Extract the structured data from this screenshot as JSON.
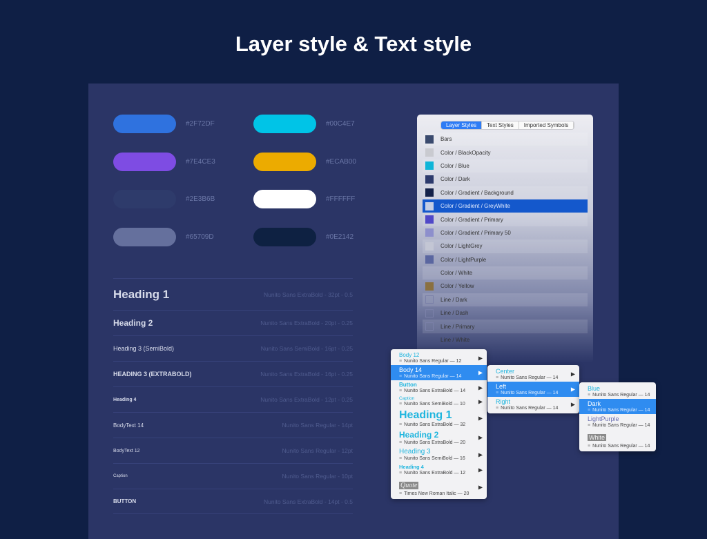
{
  "title": "Layer style & Text style",
  "swatches": [
    {
      "color": "#2F72DF",
      "label": "#2F72DF"
    },
    {
      "color": "#00C4E7",
      "label": "#00C4E7"
    },
    {
      "color": "#7E4CE3",
      "label": "#7E4CE3"
    },
    {
      "color": "#ECAB00",
      "label": "#ECAB00"
    },
    {
      "color": "#2E3B6B",
      "label": "#2E3B6B"
    },
    {
      "color": "#FFFFFF",
      "label": "#FFFFFF"
    },
    {
      "color": "#65709D",
      "label": "#65709D"
    },
    {
      "color": "#0E2142",
      "label": "#0E2142"
    }
  ],
  "text_styles": [
    {
      "name": "Heading 1",
      "spec": "Nunito Sans ExtraBold - 32pt - 0.5"
    },
    {
      "name": "Heading 2",
      "spec": "Nunito Sans ExtraBold - 20pt - 0.25"
    },
    {
      "name": "Heading 3 (SemiBold)",
      "spec": "Nunito Sans SemiBold - 16pt - 0.25"
    },
    {
      "name": "HEADING 3 (EXTRABOLD)",
      "spec": "Nunito Sans ExtraBold - 16pt - 0.25"
    },
    {
      "name": "Heading 4",
      "spec": "Nunito Sans ExtraBold - 12pt - 0.25"
    },
    {
      "name": "BodyText 14",
      "spec": "Nunito Sans Regular - 14pt"
    },
    {
      "name": "BodyText 12",
      "spec": "Nunito Sans Regular - 12pt"
    },
    {
      "name": "Caption",
      "spec": "Nunito Sans Regular - 10pt"
    },
    {
      "name": "BUTTON",
      "spec": "Nunito Sans ExtraBold - 14pt - 0.5"
    }
  ],
  "layer_panel": {
    "tabs": [
      "Layer Styles",
      "Text Styles",
      "Imported Symbols"
    ],
    "active_tab": "Layer Styles",
    "items": [
      {
        "label": "Bars",
        "color": "#3a4a6e"
      },
      {
        "label": "Color / BlackOpacity",
        "color": "#c9cad0"
      },
      {
        "label": "Color / Blue",
        "color": "#10b5d8"
      },
      {
        "label": "Color / Dark",
        "color": "#2c3a6c"
      },
      {
        "label": "Color / Gradient / Background",
        "color": "#15224a"
      },
      {
        "label": "Color / Gradient / GreyWhite",
        "color": "#c4cde4",
        "selected": true
      },
      {
        "label": "Color / Gradient / Primary",
        "color": "#5048c8"
      },
      {
        "label": "Color / Gradient / Primary 50",
        "color": "#8d8fcc"
      },
      {
        "label": "Color / LightGrey",
        "color": "#c3c6d4"
      },
      {
        "label": "Color / LightPurple",
        "color": "#5a66a0"
      },
      {
        "label": "Color / White",
        "color": ""
      },
      {
        "label": "Color / Yellow",
        "color": "#8a7040"
      },
      {
        "label": "Line / Dark",
        "color": "outline"
      },
      {
        "label": "Line / Dash",
        "color": "outline"
      },
      {
        "label": "Line / Primary",
        "color": "outline"
      },
      {
        "label": "Line / White",
        "color": ""
      }
    ]
  },
  "menu1": [
    {
      "label": "Body 12",
      "sub": "Nunito Sans Regular — 12",
      "size": 8
    },
    {
      "label": "Body 14",
      "sub": "Nunito Sans Regular — 14",
      "size": 9,
      "selected": true
    },
    {
      "label": "Button",
      "sub": "Nunito Sans ExtraBold — 14",
      "size": 8,
      "bold": true
    },
    {
      "label": "Caption",
      "sub": "Nunito Sans SemiBold — 10",
      "size": 6.5
    },
    {
      "label": "Heading 1",
      "sub": "Nunito Sans ExtraBold — 32",
      "size": 16,
      "bold": true
    },
    {
      "label": "Heading 2",
      "sub": "Nunito Sans ExtraBold — 20",
      "size": 12,
      "bold": true
    },
    {
      "label": "Heading 3",
      "sub": "Nunito Sans SemiBold — 16",
      "size": 10
    },
    {
      "label": "Heading 4",
      "sub": "Nunito Sans ExtraBold — 12",
      "size": 7.5,
      "bold": true
    },
    {
      "label": "Quote",
      "sub": "Times New Roman Italic — 20",
      "size": 10,
      "quote": true
    }
  ],
  "menu2": [
    {
      "label": "Center",
      "sub": "Nunito Sans Regular — 14"
    },
    {
      "label": "Left",
      "sub": "Nunito Sans Regular — 14",
      "selected": true
    },
    {
      "label": "Right",
      "sub": "Nunito Sans Regular — 14"
    }
  ],
  "menu3": [
    {
      "label": "Blue",
      "sub": "Nunito Sans Regular — 14"
    },
    {
      "label": "Dark",
      "sub": "Nunito Sans Regular — 14",
      "selected": true
    },
    {
      "label": "LightPurple",
      "sub": "Nunito Sans Regular — 14",
      "purple": true
    },
    {
      "label": "White",
      "sub": "Nunito Sans Regular — 14",
      "white": true
    }
  ]
}
